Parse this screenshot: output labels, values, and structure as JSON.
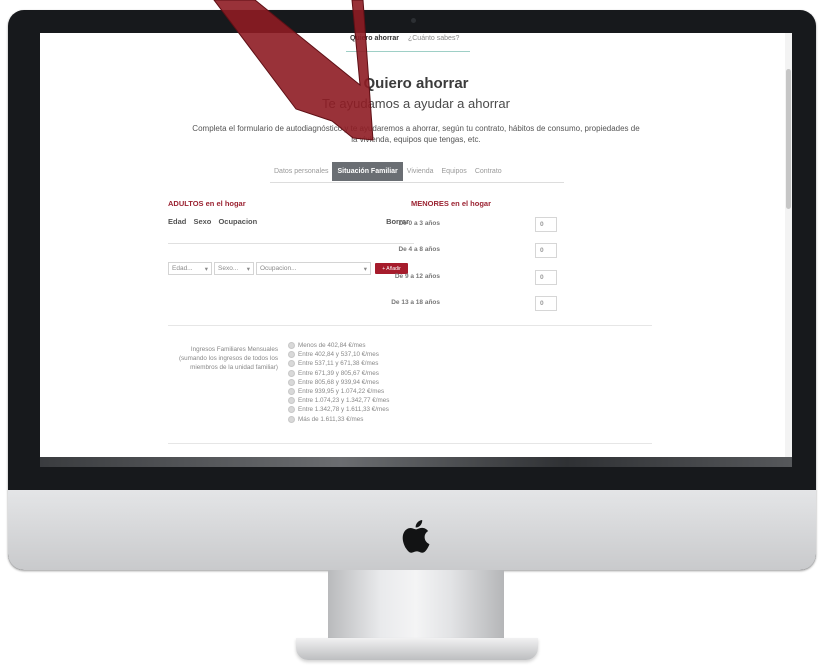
{
  "nav": {
    "items": [
      "Quiero ahorrar",
      "¿Cuánto sabes?"
    ]
  },
  "hero": {
    "title": "Quiero ahorrar",
    "subtitle": "Te ayudamos a ayudar a ahorrar",
    "intro": "Completa el formulario de autodiagnóstico y te ayudaremos a ahorrar, según tu contrato, hábitos de consumo, propiedades de la vivienda, equipos que tengas, etc."
  },
  "steps": [
    "Datos personales",
    "Situación Familiar",
    "Vivienda",
    "Equipos",
    "Contrato"
  ],
  "adults": {
    "heading": "ADULTOS en el hogar",
    "col_edad": "Edad",
    "col_sexo": "Sexo",
    "col_ocupacion": "Ocupacion",
    "col_borrar": "Borrar",
    "select_edad": "Edad...",
    "select_sexo": "Sexo...",
    "select_ocupacion": "Ocupacion...",
    "add_button": "+ Añadir"
  },
  "minors": {
    "heading": "MENORES en el hogar",
    "rows": [
      {
        "label": "De 0 a 3 años",
        "value": "0"
      },
      {
        "label": "De 4 a 8 años",
        "value": "0"
      },
      {
        "label": "De 9 a 12 años",
        "value": "0"
      },
      {
        "label": "De 13 a 18 años",
        "value": "0"
      }
    ]
  },
  "income": {
    "label": "Ingresos Familiares Mensuales (sumando los ingresos de todos los miembros de la unidad familiar)",
    "options": [
      "Menos de 402,84 €/mes",
      "Entre 402,84 y 537,10 €/mes",
      "Entre 537,11 y 671,38 €/mes",
      "Entre 671,39 y 805,67 €/mes",
      "Entre 805,68 y 939,94 €/mes",
      "Entre 939,95 y 1.074,22 €/mes",
      "Entre 1.074,23 y 1.342,77 €/mes",
      "Entre 1.342,78 y 1.611,33 €/mes",
      "Más de 1.611,33 €/mes"
    ]
  },
  "colors": {
    "accent": "#9b2332",
    "button": "#a61c2c",
    "active_step": "#6a6e73",
    "arrow": "#8e1c24"
  },
  "icons": {
    "brand": "apple-logo-icon",
    "pointer": "red-arrow-icon"
  }
}
